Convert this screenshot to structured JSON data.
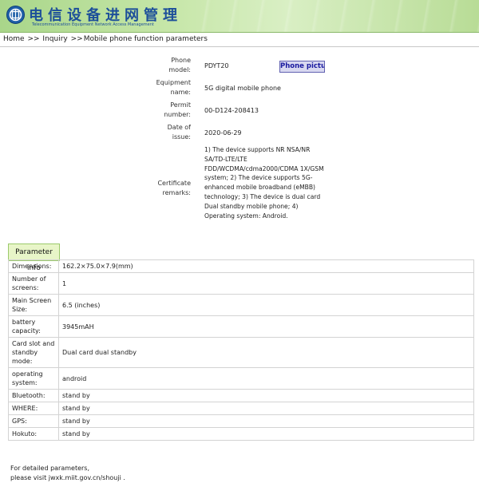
{
  "header": {
    "title": "电信设备进网管理",
    "subtitle": "Telecommunication Equipment Network Access Management",
    "logo_icon": "network-access-logo"
  },
  "breadcrumb": {
    "home": "Home",
    "sep1": ">>",
    "inquiry": "Inquiry",
    "sep2": ">>",
    "current": "Mobile phone function parameters"
  },
  "info": {
    "phone_model_label": "Phone model:",
    "phone_model_value": "PDYT20",
    "photo_button": "Phone pictu",
    "equipment_name_label": "Equipment name:",
    "equipment_name_value": "5G digital mobile phone",
    "permit_label": "Permit number:",
    "permit_value": "00-D124-208413",
    "date_label": "Date of issue:",
    "date_value": "2020-06-29",
    "remarks_label": "Certificate remarks:",
    "remarks_value": "1) The device supports NR NSA/NR SA/TD-LTE/LTE FDD/WCDMA/cdma2000/CDMA 1X/GSM system; 2) The device supports 5G-enhanced mobile broadband (eMBB) technology; 3) The device is dual card Dual standby mobile phone; 4) Operating system: Android."
  },
  "params": {
    "tab_label": "Parameter info",
    "rows": [
      {
        "key": "Dimensions:",
        "value": "162.2×75.0×7.9(mm)"
      },
      {
        "key": "Number of screens:",
        "value": "1"
      },
      {
        "key": "Main Screen Size:",
        "value": "6.5 (inches)"
      },
      {
        "key": "battery capacity:",
        "value": "3945mAH"
      },
      {
        "key": "Card slot and standby mode:",
        "value": "Dual card dual standby"
      },
      {
        "key": "operating system:",
        "value": "android"
      },
      {
        "key": "Bluetooth:",
        "value": "stand by"
      },
      {
        "key": "WHERE:",
        "value": "stand by"
      },
      {
        "key": "GPS:",
        "value": "stand by"
      },
      {
        "key": "Hokuto:",
        "value": "stand by"
      }
    ]
  },
  "footer": {
    "line1": "For detailed parameters,",
    "line2": "please visit jwxk.miit.gov.cn/shouji ."
  }
}
